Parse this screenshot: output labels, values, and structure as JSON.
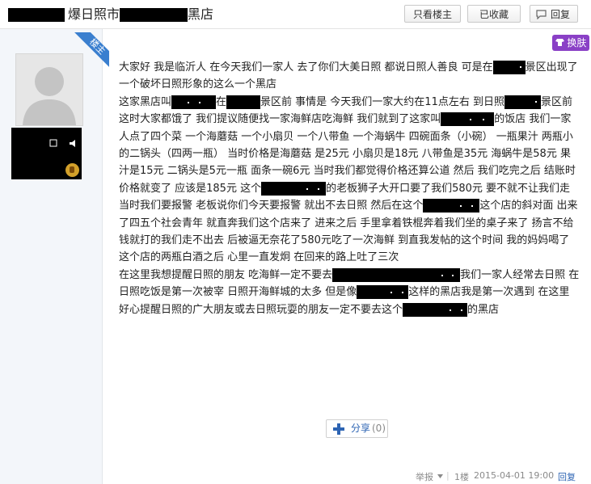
{
  "header": {
    "title_before": "爆日照市",
    "title_after": "黑店",
    "buttons": {
      "only_op": "只看楼主",
      "favorited": "已收藏",
      "reply": "回复"
    }
  },
  "author": {
    "badge": "楼主"
  },
  "swap_label": "换肤",
  "post": {
    "p1_a": "大家好 我是临沂人 在今天我们一家人 去了你们大美日照 都说日照人善良 可是在",
    "p1_b": "景区出现了一个破坏日照形象的这么一个黑店",
    "p2_a": "这家黑店叫",
    "p2_b": "在",
    "p2_c": "景区前 事情是 今天我们一家大约在11点左右 到日照",
    "p2_d": "景区前 这时大家都饿了 我们提议随便找一家海鲜店吃海鲜 我们就到了这家叫",
    "p2_e": "的饭店 我们一家人点了四个菜 一个海蘑菇 一个小扇贝 一个八带鱼 一个海蜗牛 四碗面条（小碗） 一瓶果汁 两瓶小的二锅头（四两一瓶） 当时价格是海蘑菇 是25元 小扇贝是18元 八带鱼是35元 海蜗牛是58元 果汁是15元 二锅头是5元一瓶 面条一碗6元 当时我们都觉得价格还算公道 然后 我们吃完之后 结账时 价格就变了 应该是185元 这个",
    "p2_f": "的老板狮子大开口要了我们580元 要不就不让我们走 当时我们要报警 老板说你们今天要报警 就出不去日照 然后在这个",
    "p2_g": "这个店的斜对面 出来了四五个社会青年 就直奔我们这个店来了 进来之后 手里拿着铁棍奔着我们坐的桌子来了 扬言不给钱就打的我们走不出去 后被逼无奈花了580元吃了一次海鲜 到直我发帖的这个时间 我的妈妈喝了这个店的两瓶白酒之后 心里一直发炯 在回来的路上吐了三次",
    "p3_a": "在这里我想提醒日照的朋友 吃海鲜一定不要去",
    "p3_b": "我们一家人经常去日照 在日照吃饭是第一次被宰 日照开海鲜城的太多 但是像",
    "p3_c": "这样的黑店我是第一次遇到 在这里 好心提醒日照的广大朋友或去日照玩耍的朋友一定不要去这个",
    "p3_d": "的黑店"
  },
  "share": {
    "label": "分享",
    "count": "(0)"
  },
  "footer": {
    "report": "举报",
    "floor": "1楼",
    "datetime": "2015-04-01 19:00",
    "reply": "回复"
  }
}
